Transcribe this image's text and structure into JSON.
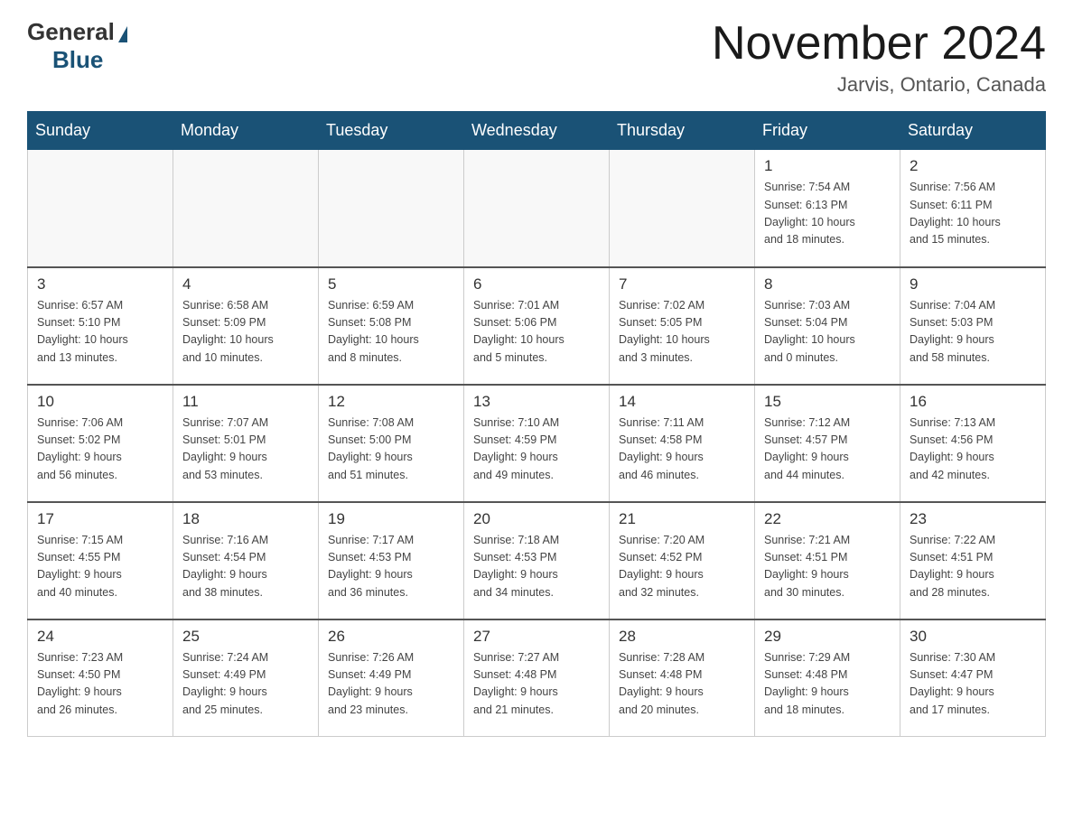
{
  "header": {
    "logo_general": "General",
    "logo_blue": "Blue",
    "month_title": "November 2024",
    "location": "Jarvis, Ontario, Canada"
  },
  "days_of_week": [
    "Sunday",
    "Monday",
    "Tuesday",
    "Wednesday",
    "Thursday",
    "Friday",
    "Saturday"
  ],
  "weeks": [
    [
      {
        "day": "",
        "info": ""
      },
      {
        "day": "",
        "info": ""
      },
      {
        "day": "",
        "info": ""
      },
      {
        "day": "",
        "info": ""
      },
      {
        "day": "",
        "info": ""
      },
      {
        "day": "1",
        "info": "Sunrise: 7:54 AM\nSunset: 6:13 PM\nDaylight: 10 hours\nand 18 minutes."
      },
      {
        "day": "2",
        "info": "Sunrise: 7:56 AM\nSunset: 6:11 PM\nDaylight: 10 hours\nand 15 minutes."
      }
    ],
    [
      {
        "day": "3",
        "info": "Sunrise: 6:57 AM\nSunset: 5:10 PM\nDaylight: 10 hours\nand 13 minutes."
      },
      {
        "day": "4",
        "info": "Sunrise: 6:58 AM\nSunset: 5:09 PM\nDaylight: 10 hours\nand 10 minutes."
      },
      {
        "day": "5",
        "info": "Sunrise: 6:59 AM\nSunset: 5:08 PM\nDaylight: 10 hours\nand 8 minutes."
      },
      {
        "day": "6",
        "info": "Sunrise: 7:01 AM\nSunset: 5:06 PM\nDaylight: 10 hours\nand 5 minutes."
      },
      {
        "day": "7",
        "info": "Sunrise: 7:02 AM\nSunset: 5:05 PM\nDaylight: 10 hours\nand 3 minutes."
      },
      {
        "day": "8",
        "info": "Sunrise: 7:03 AM\nSunset: 5:04 PM\nDaylight: 10 hours\nand 0 minutes."
      },
      {
        "day": "9",
        "info": "Sunrise: 7:04 AM\nSunset: 5:03 PM\nDaylight: 9 hours\nand 58 minutes."
      }
    ],
    [
      {
        "day": "10",
        "info": "Sunrise: 7:06 AM\nSunset: 5:02 PM\nDaylight: 9 hours\nand 56 minutes."
      },
      {
        "day": "11",
        "info": "Sunrise: 7:07 AM\nSunset: 5:01 PM\nDaylight: 9 hours\nand 53 minutes."
      },
      {
        "day": "12",
        "info": "Sunrise: 7:08 AM\nSunset: 5:00 PM\nDaylight: 9 hours\nand 51 minutes."
      },
      {
        "day": "13",
        "info": "Sunrise: 7:10 AM\nSunset: 4:59 PM\nDaylight: 9 hours\nand 49 minutes."
      },
      {
        "day": "14",
        "info": "Sunrise: 7:11 AM\nSunset: 4:58 PM\nDaylight: 9 hours\nand 46 minutes."
      },
      {
        "day": "15",
        "info": "Sunrise: 7:12 AM\nSunset: 4:57 PM\nDaylight: 9 hours\nand 44 minutes."
      },
      {
        "day": "16",
        "info": "Sunrise: 7:13 AM\nSunset: 4:56 PM\nDaylight: 9 hours\nand 42 minutes."
      }
    ],
    [
      {
        "day": "17",
        "info": "Sunrise: 7:15 AM\nSunset: 4:55 PM\nDaylight: 9 hours\nand 40 minutes."
      },
      {
        "day": "18",
        "info": "Sunrise: 7:16 AM\nSunset: 4:54 PM\nDaylight: 9 hours\nand 38 minutes."
      },
      {
        "day": "19",
        "info": "Sunrise: 7:17 AM\nSunset: 4:53 PM\nDaylight: 9 hours\nand 36 minutes."
      },
      {
        "day": "20",
        "info": "Sunrise: 7:18 AM\nSunset: 4:53 PM\nDaylight: 9 hours\nand 34 minutes."
      },
      {
        "day": "21",
        "info": "Sunrise: 7:20 AM\nSunset: 4:52 PM\nDaylight: 9 hours\nand 32 minutes."
      },
      {
        "day": "22",
        "info": "Sunrise: 7:21 AM\nSunset: 4:51 PM\nDaylight: 9 hours\nand 30 minutes."
      },
      {
        "day": "23",
        "info": "Sunrise: 7:22 AM\nSunset: 4:51 PM\nDaylight: 9 hours\nand 28 minutes."
      }
    ],
    [
      {
        "day": "24",
        "info": "Sunrise: 7:23 AM\nSunset: 4:50 PM\nDaylight: 9 hours\nand 26 minutes."
      },
      {
        "day": "25",
        "info": "Sunrise: 7:24 AM\nSunset: 4:49 PM\nDaylight: 9 hours\nand 25 minutes."
      },
      {
        "day": "26",
        "info": "Sunrise: 7:26 AM\nSunset: 4:49 PM\nDaylight: 9 hours\nand 23 minutes."
      },
      {
        "day": "27",
        "info": "Sunrise: 7:27 AM\nSunset: 4:48 PM\nDaylight: 9 hours\nand 21 minutes."
      },
      {
        "day": "28",
        "info": "Sunrise: 7:28 AM\nSunset: 4:48 PM\nDaylight: 9 hours\nand 20 minutes."
      },
      {
        "day": "29",
        "info": "Sunrise: 7:29 AM\nSunset: 4:48 PM\nDaylight: 9 hours\nand 18 minutes."
      },
      {
        "day": "30",
        "info": "Sunrise: 7:30 AM\nSunset: 4:47 PM\nDaylight: 9 hours\nand 17 minutes."
      }
    ]
  ]
}
